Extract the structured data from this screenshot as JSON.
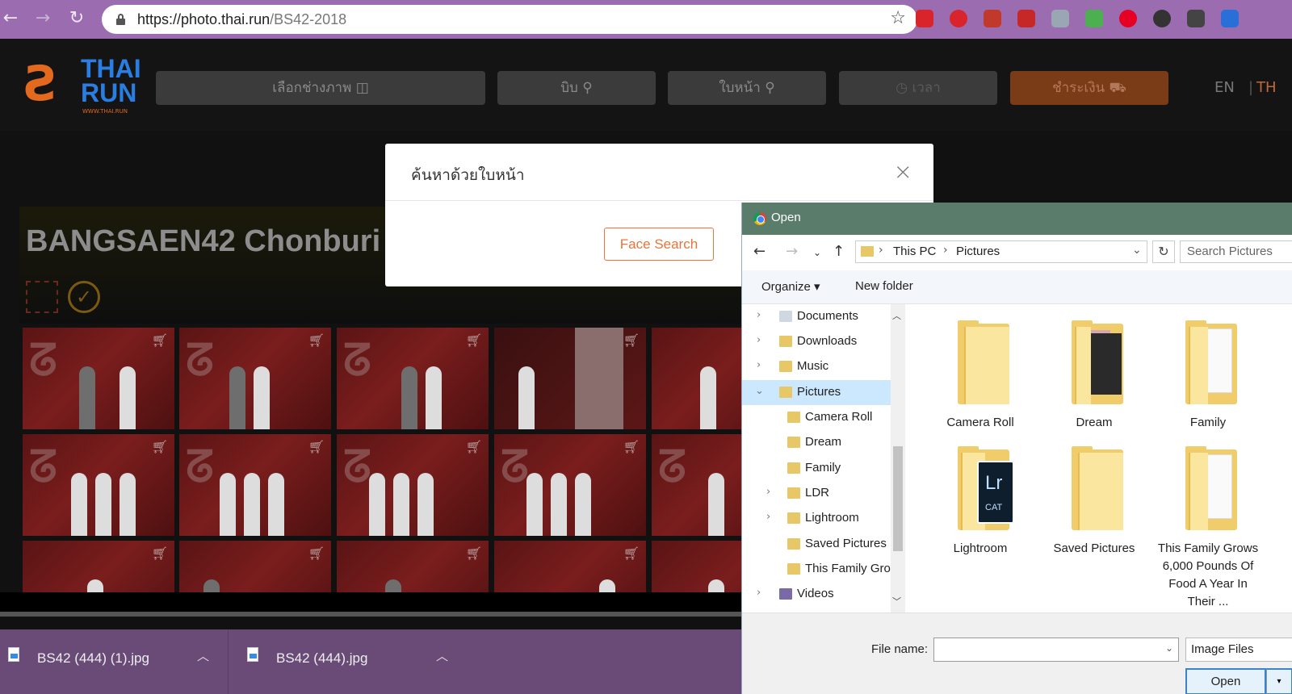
{
  "browser": {
    "url_host": "https://photo.thai.run",
    "url_path": "/BS42-2018",
    "colors": {
      "chrome": "#9b6db0"
    }
  },
  "site": {
    "logo_line1": "THAI",
    "logo_line2": "RUN",
    "logo_sub": "WWW.THAI.RUN",
    "nav": {
      "photographer": "เลือกช่างภาพ",
      "bib": "บิบ",
      "face": "ใบหน้า",
      "time": "เวลา",
      "pay": "ชำระเงิน"
    },
    "lang_en": "EN",
    "lang_th": "TH",
    "event_title": "BANGSAEN42 Chonburi",
    "colors": {
      "accent": "#e8743b",
      "logo_blue": "#2a7de1"
    }
  },
  "modal": {
    "title": "ค้นหาด้วยใบหน้า",
    "close": "×",
    "face_search": "Face Search"
  },
  "downloads": [
    {
      "name": "BS42 (444) (1).jpg"
    },
    {
      "name": "BS42 (444).jpg"
    }
  ],
  "dialog": {
    "title": "Open",
    "breadcrumb": [
      "This PC",
      "Pictures"
    ],
    "search_placeholder": "Search Pictures",
    "organize": "Organize ▾",
    "new_folder": "New folder",
    "tree": [
      {
        "label": "Documents",
        "expandable": true,
        "selected": false
      },
      {
        "label": "Downloads",
        "expandable": true,
        "selected": false
      },
      {
        "label": "Music",
        "expandable": true,
        "selected": false
      },
      {
        "label": "Pictures",
        "expandable": true,
        "selected": true,
        "expanded": true
      },
      {
        "label": "Camera Roll",
        "expandable": false,
        "selected": false
      },
      {
        "label": "Dream",
        "expandable": false,
        "selected": false
      },
      {
        "label": "Family",
        "expandable": false,
        "selected": false
      },
      {
        "label": "LDR",
        "expandable": true,
        "selected": false
      },
      {
        "label": "Lightroom",
        "expandable": true,
        "selected": false
      },
      {
        "label": "Saved Pictures",
        "expandable": false,
        "selected": false
      },
      {
        "label": "This Family Gro",
        "expandable": false,
        "selected": false
      },
      {
        "label": "Videos",
        "expandable": true,
        "selected": false
      }
    ],
    "files": [
      {
        "label": "Camera Roll",
        "kind": "empty"
      },
      {
        "label": "Dream",
        "kind": "photos"
      },
      {
        "label": "Family",
        "kind": "docs"
      },
      {
        "label": "Lightroom",
        "kind": "lightroom"
      },
      {
        "label": "Saved Pictures",
        "kind": "empty"
      },
      {
        "label": "This Family Grows 6,000 Pounds Of Food A Year In Their ...",
        "kind": "docs"
      }
    ],
    "lr_label": "Lr",
    "lr_cat": "CAT",
    "file_name_label": "File name:",
    "file_name_value": "",
    "file_type": "Image Files",
    "open_button": "Open"
  }
}
